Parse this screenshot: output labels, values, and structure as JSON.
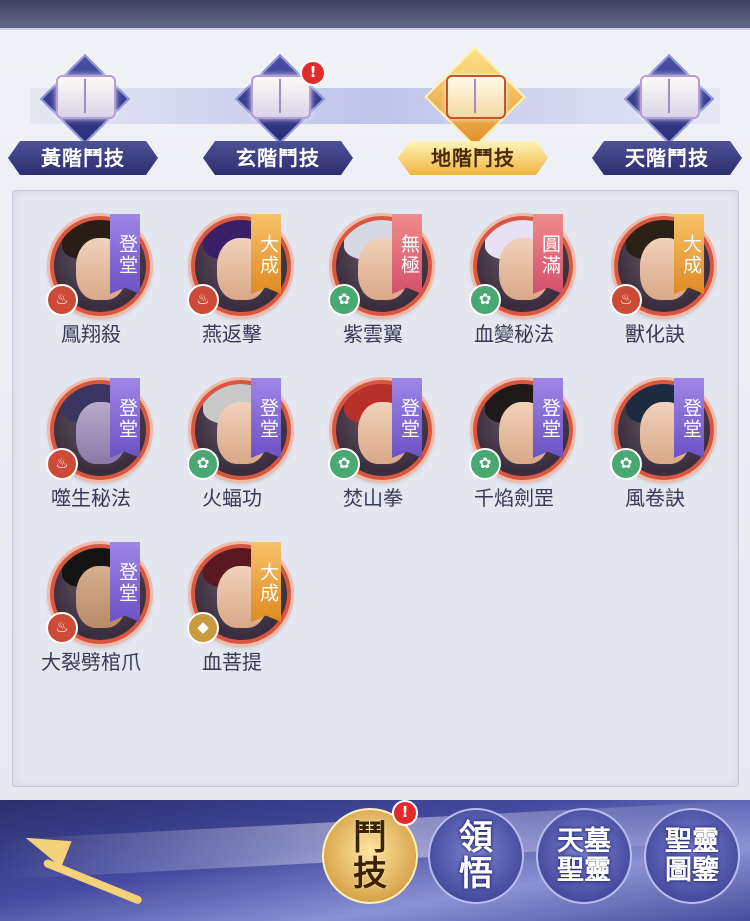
{
  "tabs": [
    {
      "label": "黃階鬥技",
      "alert": false
    },
    {
      "label": "玄階鬥技",
      "alert": true
    },
    {
      "label": "地階鬥技",
      "alert": false,
      "active": true
    },
    {
      "label": "天階鬥技",
      "alert": false
    }
  ],
  "alert_mark": "!",
  "skills": [
    {
      "name": "鳳翔殺",
      "tier": "登堂",
      "element": "fire"
    },
    {
      "name": "燕返擊",
      "tier": "大成",
      "element": "fire"
    },
    {
      "name": "紫雲翼",
      "tier": "無極",
      "element": "wood"
    },
    {
      "name": "血變秘法",
      "tier": "圓滿",
      "element": "wood"
    },
    {
      "name": "獸化訣",
      "tier": "大成",
      "element": "fire"
    },
    {
      "name": "噬生秘法",
      "tier": "登堂",
      "element": "fire"
    },
    {
      "name": "火蝠功",
      "tier": "登堂",
      "element": "wood"
    },
    {
      "name": "焚山拳",
      "tier": "登堂",
      "element": "wood"
    },
    {
      "name": "千焰劍罡",
      "tier": "登堂",
      "element": "wood"
    },
    {
      "name": "風卷訣",
      "tier": "登堂",
      "element": "wood"
    },
    {
      "name": "大裂劈棺爪",
      "tier": "登堂",
      "element": "fire"
    },
    {
      "name": "血菩提",
      "tier": "大成",
      "element": "metal"
    }
  ],
  "bottom_nav": [
    {
      "line1": "鬥",
      "line2": "技",
      "alert": true,
      "active": true
    },
    {
      "line1": "領",
      "line2": "悟",
      "alert": false
    },
    {
      "line1": "天墓",
      "line2": "聖靈",
      "alert": false
    },
    {
      "line1": "聖靈",
      "line2": "圖鑒",
      "alert": false
    }
  ],
  "colors": {
    "frame_red": "#d8573e",
    "tag_purple": "#8a70d8",
    "tag_gold": "#eaa23a",
    "tag_pink": "#e07080",
    "accent_gold": "#f0b640",
    "nav_blue": "#2f3488"
  }
}
